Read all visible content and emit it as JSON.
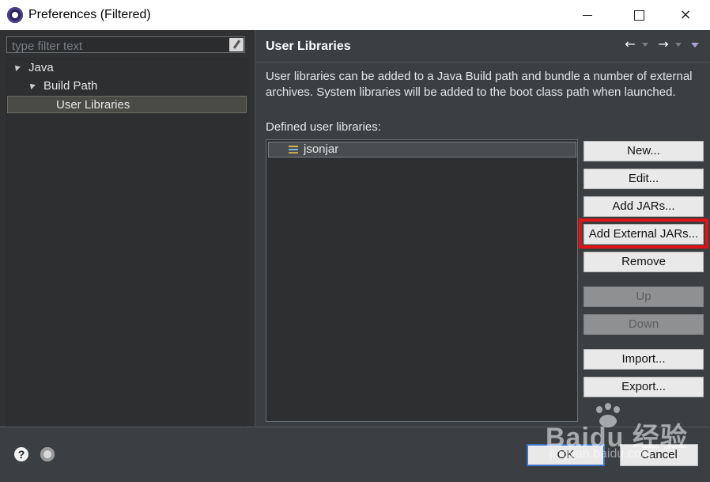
{
  "window": {
    "title": "Preferences (Filtered)",
    "controls": {
      "minimize": "minimize",
      "maximize": "maximize",
      "close": "×"
    }
  },
  "left": {
    "filter_placeholder": "type filter text",
    "tree": [
      {
        "label": "Java",
        "expanded": true,
        "level": 0
      },
      {
        "label": "Build Path",
        "expanded": true,
        "level": 1
      },
      {
        "label": "User Libraries",
        "selected": true,
        "level": 2
      }
    ]
  },
  "main": {
    "title": "User Libraries",
    "nav": {
      "back": "←",
      "forward": "→"
    },
    "description": "User libraries can be added to a Java Build path and bundle a number of external archives. System libraries will be added to the boot class path when launched.",
    "defined_label": "Defined user libraries:",
    "libraries": [
      {
        "name": "jsonjar"
      }
    ],
    "buttons": {
      "new": "New...",
      "edit": "Edit...",
      "add_jars": "Add JARs...",
      "add_external_jars": "Add External JARs...",
      "remove": "Remove",
      "up": "Up",
      "down": "Down",
      "import": "Import...",
      "export": "Export..."
    }
  },
  "footer": {
    "help": "?",
    "ok": "OK",
    "cancel": "Cancel"
  },
  "watermark": {
    "brand": "Baidu 经验",
    "url": "jingyan.baidu.com"
  },
  "colors": {
    "highlight_box": "#e01414",
    "panel_bg": "#3b3f42",
    "tree_bg": "#2d2f31"
  }
}
